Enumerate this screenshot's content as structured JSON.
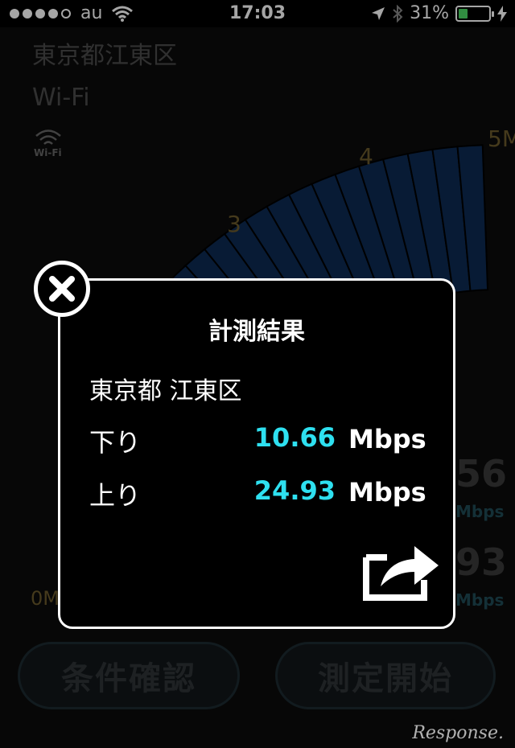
{
  "status_bar": {
    "carrier": "au",
    "time": "17:03",
    "battery_percent": "31%",
    "battery_level": 0.31
  },
  "background": {
    "location": "東京都江東区",
    "network_type": "Wi-Fi",
    "wifi_badge_label": "Wi-Fi",
    "gauge_labels": [
      "0M",
      "3",
      "4",
      "5M"
    ],
    "download_partial": "56",
    "download_unit": "Mbps",
    "upload_partial": "93",
    "upload_unit": "Mbps"
  },
  "buttons": {
    "conditions": "条件確認",
    "start": "測定開始"
  },
  "watermark": "Response.",
  "modal": {
    "title": "計測結果",
    "location": "東京都 江東区",
    "download_label": "下り",
    "download_value": "10.66",
    "upload_label": "上り",
    "upload_value": "24.93",
    "unit": "Mbps"
  },
  "colors": {
    "value_accent": "#2ee0f0",
    "gauge_fill": "#0d2a52",
    "battery": "#4cd964"
  }
}
